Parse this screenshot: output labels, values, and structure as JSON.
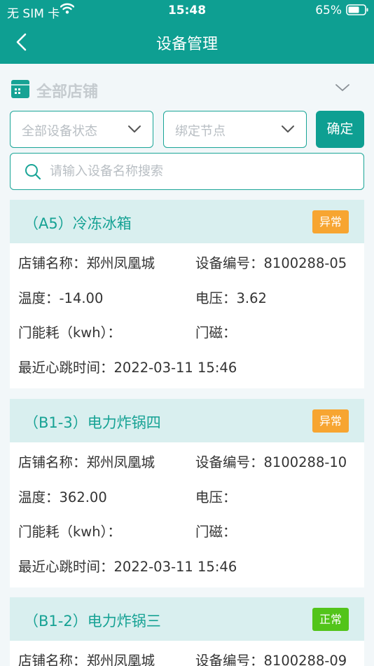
{
  "status_bar": {
    "carrier": "无 SIM 卡",
    "time": "15:48",
    "battery": "65%"
  },
  "nav": {
    "title": "设备管理",
    "back_icon": "chevron-left-icon"
  },
  "store_filter": {
    "label": "全部店铺",
    "icon": "store-icon"
  },
  "filters": {
    "status": "全部设备状态",
    "node": "绑定节点",
    "confirm": "确定"
  },
  "search": {
    "placeholder": "请输入设备名称搜索"
  },
  "colors": {
    "primary": "#0e9f92",
    "abnormal": "#f7a531",
    "normal": "#52c41a",
    "card_header": "#d9efef"
  },
  "devices": [
    {
      "title": "（A5）冷冻冰箱",
      "status": "异常",
      "status_type": "abnormal",
      "store": "店铺名称：郑州凤凰城",
      "code": "设备编号：8100288-05",
      "temp": "温度：-14.00",
      "voltage": "电压：3.62",
      "energy": "门能耗（kwh）：",
      "magnet": "门磁：",
      "heartbeat": "最近心跳时间：2022-03-11 15:46"
    },
    {
      "title": "（B1-3）电力炸锅四",
      "status": "异常",
      "status_type": "abnormal",
      "store": "店铺名称：郑州凤凰城",
      "code": "设备编号：8100288-10",
      "temp": "温度：362.00",
      "voltage": "电压：",
      "energy": "门能耗（kwh）：",
      "magnet": "门磁：",
      "heartbeat": "最近心跳时间：2022-03-11 15:46"
    },
    {
      "title": "（B1-2）电力炸锅三",
      "status": "正常",
      "status_type": "normal",
      "store": "店铺名称：郑州凤凰城",
      "code": "设备编号：8100288-09"
    }
  ]
}
